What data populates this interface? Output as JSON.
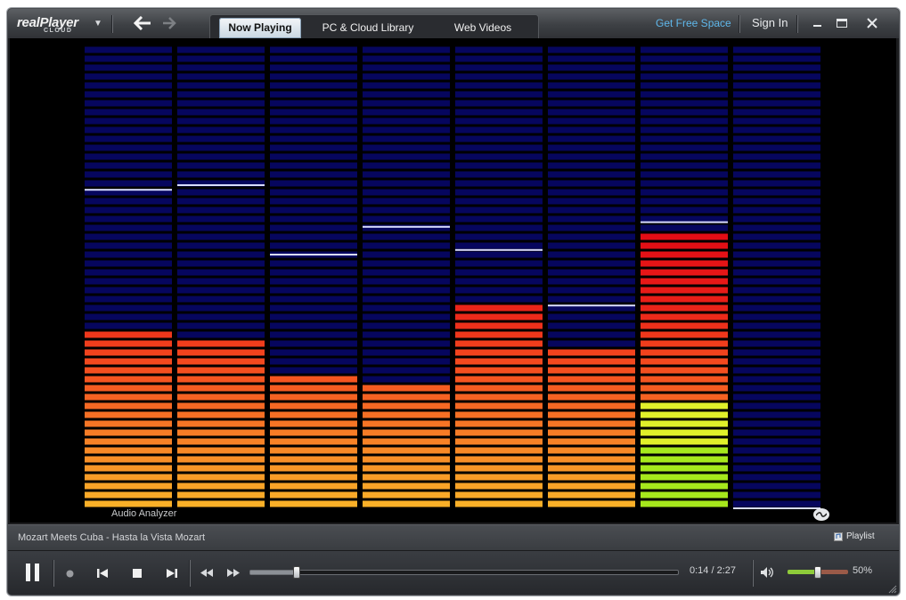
{
  "app": {
    "logo_main": "realPlayer",
    "logo_sub": "CLOUD"
  },
  "tabs": [
    {
      "label": "Now Playing",
      "active": true
    },
    {
      "label": "PC & Cloud Library",
      "active": false
    },
    {
      "label": "Web Videos",
      "active": false
    }
  ],
  "header": {
    "free_space": "Get Free Space",
    "sign_in": "Sign In"
  },
  "visualizer": {
    "label": "Audio Analyzer",
    "levels": [
      0.39,
      0.36,
      0.29,
      0.27,
      0.44,
      0.35,
      0.6,
      0.0
    ],
    "peaks": [
      0.69,
      0.7,
      0.55,
      0.61,
      0.56,
      0.44,
      0.62,
      0.0
    ]
  },
  "now_playing": {
    "track": "Mozart Meets Cuba - Hasta la Vista Mozart",
    "playlist_label": "Playlist"
  },
  "transport": {
    "time": "0:14 / 2:27",
    "progress": 0.108,
    "volume": 0.5,
    "volume_label": "50%"
  },
  "colors": {
    "accent_link": "#5fb7ea",
    "title_text": "#e8eaec",
    "bar_empty": "#06065e"
  }
}
